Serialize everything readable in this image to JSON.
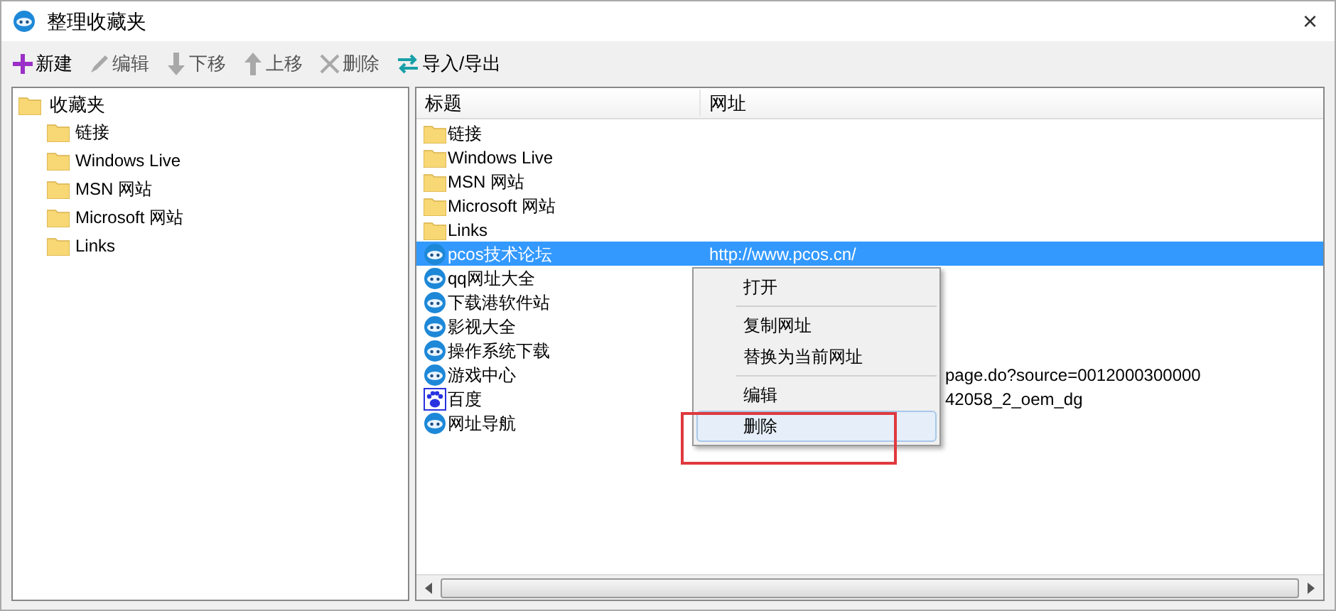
{
  "window": {
    "title": "整理收藏夹",
    "close": "×"
  },
  "toolbar": [
    {
      "kind": "plus",
      "label": "新建",
      "disabled": false
    },
    {
      "kind": "pencil",
      "label": "编辑",
      "disabled": true
    },
    {
      "kind": "down",
      "label": "下移",
      "disabled": true
    },
    {
      "kind": "up",
      "label": "上移",
      "disabled": true
    },
    {
      "kind": "x",
      "label": "删除",
      "disabled": true
    },
    {
      "kind": "swap",
      "label": "导入/导出",
      "disabled": false
    }
  ],
  "tree": {
    "label": "收藏夹",
    "children": [
      {
        "label": "链接"
      },
      {
        "label": "Windows Live"
      },
      {
        "label": "MSN 网站"
      },
      {
        "label": "Microsoft 网站"
      },
      {
        "label": "Links"
      }
    ]
  },
  "table": {
    "columns": [
      "标题",
      "网址"
    ],
    "rows": [
      {
        "kind": "folder",
        "title": "链接",
        "selected": false
      },
      {
        "kind": "folder",
        "title": "Windows Live",
        "selected": false
      },
      {
        "kind": "folder",
        "title": "MSN 网站",
        "selected": false
      },
      {
        "kind": "folder",
        "title": "Microsoft 网站",
        "selected": false
      },
      {
        "kind": "folder",
        "title": "Links",
        "selected": false
      },
      {
        "kind": "link",
        "title": "pcos技术论坛",
        "url": "http://www.pcos.cn/",
        "selected": true
      },
      {
        "kind": "link",
        "title": "qq网址大全",
        "selected": false
      },
      {
        "kind": "link",
        "title": "下载港软件站",
        "selected": false
      },
      {
        "kind": "link",
        "title": "影视大全",
        "selected": false
      },
      {
        "kind": "link",
        "title": "操作系统下载",
        "selected": false
      },
      {
        "kind": "link",
        "title": "游戏中心",
        "url_tail": "page.do?source=0012000300000",
        "selected": false
      },
      {
        "kind": "paw",
        "title": "百度",
        "url_tail": "42058_2_oem_dg",
        "selected": false
      },
      {
        "kind": "link",
        "title": "网址导航",
        "selected": false
      }
    ]
  },
  "context_menu": {
    "groups": [
      [
        {
          "label": "打开",
          "selected": false
        }
      ],
      [
        {
          "label": "复制网址",
          "selected": false
        },
        {
          "label": "替换为当前网址",
          "selected": false
        }
      ],
      [
        {
          "label": "编辑",
          "selected": false
        },
        {
          "label": "删除",
          "selected": true
        }
      ]
    ]
  }
}
